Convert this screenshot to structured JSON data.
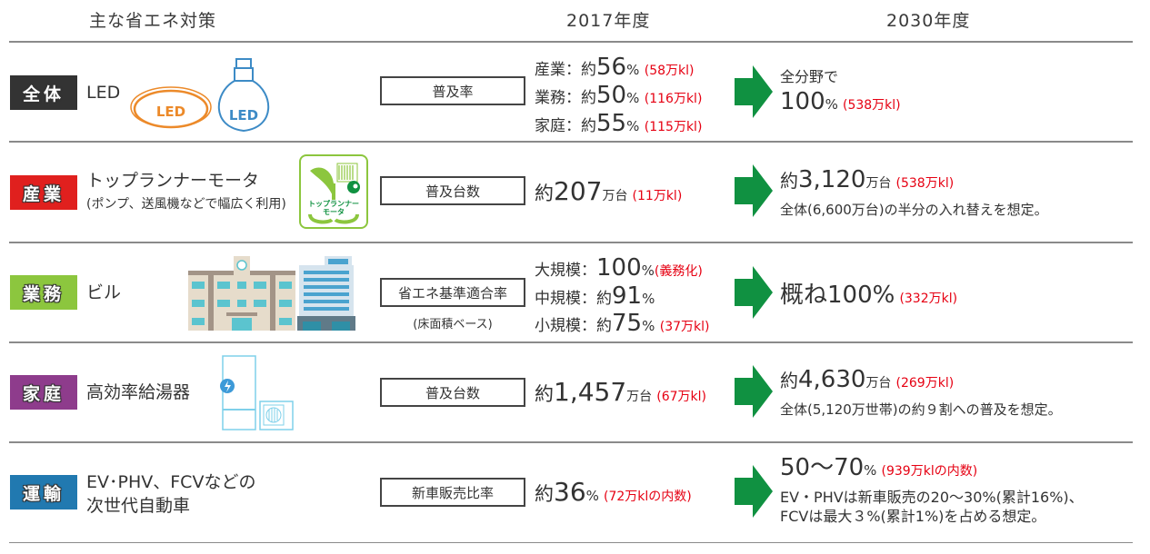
{
  "header": {
    "measures": "主な省エネ対策",
    "year_2017": "2017年度",
    "year_2030": "2030年度"
  },
  "colors": {
    "all": "#333333",
    "industry": "#e0201e",
    "business": "#8cc63e",
    "household": "#8e3c8c",
    "transport": "#2179b0",
    "arrow": "#109141",
    "note_red": "#e60012"
  },
  "rows": [
    {
      "category": "全体",
      "measure": "LED",
      "icon": "led-light-icon",
      "metric": "普及率",
      "y2017_lines": [
        {
          "label": "産業：約",
          "value": "56",
          "unit": "%",
          "note": "(58万kl)"
        },
        {
          "label": "業務：約",
          "value": "50",
          "unit": "%",
          "note": "(116万kl)"
        },
        {
          "label": "家庭：約",
          "value": "55",
          "unit": "%",
          "note": "(115万kl)"
        }
      ],
      "y2030_pre": "全分野で",
      "y2030_value": "100",
      "y2030_unit": "%",
      "y2030_note": "(538万kl)"
    },
    {
      "category": "産業",
      "measure": "トップランナーモータ",
      "measure_sub": "(ポンプ、送風機などで幅広く利用)",
      "icon": "top-runner-motor-logo-icon",
      "icon_text": [
        "トップランナー",
        "モータ"
      ],
      "metric": "普及台数",
      "y2017_prefix": "約",
      "y2017_value": "207",
      "y2017_unit": "万台",
      "y2017_note": "(11万kl)",
      "y2030_prefix": "約",
      "y2030_value": "3,120",
      "y2030_unit": "万台",
      "y2030_note": "(538万kl)",
      "y2030_desc": "全体(6,600万台)の半分の入れ替えを想定。"
    },
    {
      "category": "業務",
      "measure": "ビル",
      "icon": "building-icon",
      "metric": "省エネ基準適合率",
      "metric_note": "(床面積ベース)",
      "y2017_lines": [
        {
          "label": "大規模：",
          "value": "100",
          "unit": "%",
          "note": "(義務化)"
        },
        {
          "label": "中規模：約",
          "value": "91",
          "unit": "%",
          "note": ""
        },
        {
          "label": "小規模：約",
          "value": "75",
          "unit": "%",
          "note": "(37万kl)"
        }
      ],
      "y2030_value": "概ね100%",
      "y2030_note": "(332万kl)"
    },
    {
      "category": "家庭",
      "measure": "高効率給湯器",
      "icon": "water-heater-icon",
      "metric": "普及台数",
      "y2017_prefix": "約",
      "y2017_value": "1,457",
      "y2017_unit": "万台",
      "y2017_note": "(67万kl)",
      "y2030_prefix": "約",
      "y2030_value": "4,630",
      "y2030_unit": "万台",
      "y2030_note": "(269万kl)",
      "y2030_desc": "全体(5,120万世帯)の約９割への普及を想定。"
    },
    {
      "category": "運輸",
      "measure": "EV･PHV、FCVなどの",
      "measure_line2": "次世代自動車",
      "metric": "新車販売比率",
      "y2017_prefix": "約",
      "y2017_value": "36",
      "y2017_unit": "%",
      "y2017_note": "(72万klの内数)",
      "y2030_value": "50〜70",
      "y2030_unit": "%",
      "y2030_note": "(939万klの内数)",
      "y2030_desc": "EV・PHVは新車販売の20〜30%(累計16%)、",
      "y2030_desc2": "FCVは最大３%(累計1%)を占める想定。"
    }
  ]
}
